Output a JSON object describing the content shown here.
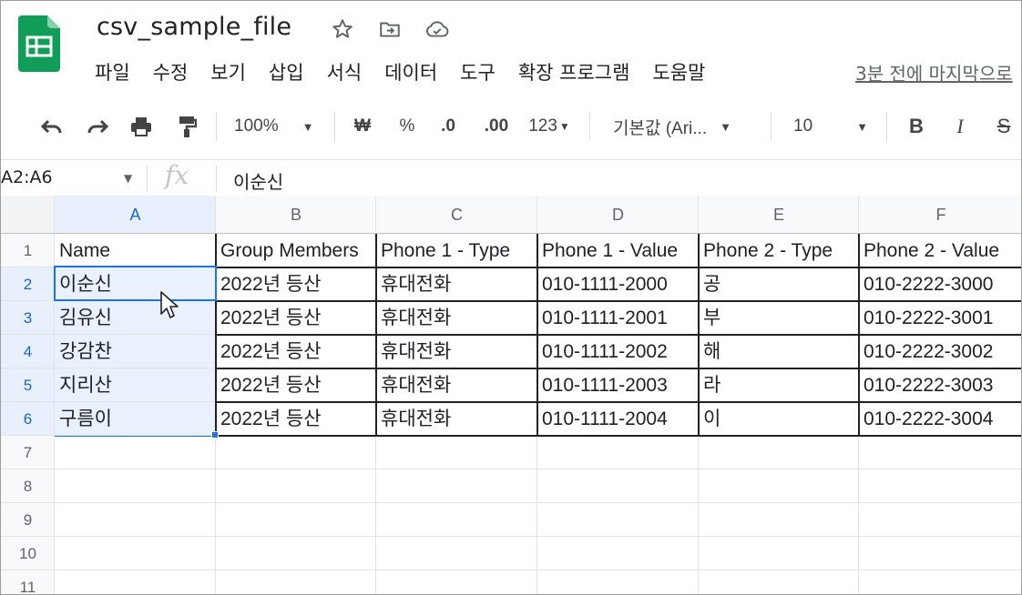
{
  "app": {
    "file_name": "csv_sample_file",
    "brand_color": "#0f9d58",
    "selection_color": "#1a73e8"
  },
  "title_icons": [
    "star-icon",
    "move-to-folder-icon",
    "cloud-saved-icon"
  ],
  "menu": {
    "items": [
      "파일",
      "수정",
      "보기",
      "삽입",
      "서식",
      "데이터",
      "도구",
      "확장 프로그램",
      "도움말"
    ],
    "last_edit": "3분 전에 마지막으로"
  },
  "toolbar": {
    "zoom": "100%",
    "currency": "₩",
    "percent": "%",
    "decimal_decrease": ".0",
    "decimal_increase": ".00",
    "format_more": "123",
    "font": "기본값 (Ari...",
    "font_size": "10",
    "bold": "B",
    "italic": "I",
    "strike": "S"
  },
  "formula_bar": {
    "name_box": "A2:A6",
    "fx": "fx",
    "value": "이순신"
  },
  "sheet": {
    "columns": [
      "A",
      "B",
      "C",
      "D",
      "E",
      "F"
    ],
    "row_numbers": [
      "1",
      "2",
      "3",
      "4",
      "5",
      "6",
      "7",
      "8",
      "9",
      "10",
      "11"
    ],
    "rows": [
      [
        "Name",
        "Group Members",
        "Phone 1 - Type",
        "Phone 1 - Value",
        "Phone 2 - Type",
        "Phone 2 - Value"
      ],
      [
        "이순신",
        "2022년 등산",
        "휴대전화",
        "010-1111-2000",
        "공",
        "010-2222-3000"
      ],
      [
        "김유신",
        "2022년 등산",
        "휴대전화",
        "010-1111-2001",
        "부",
        "010-2222-3001"
      ],
      [
        "강감찬",
        "2022년 등산",
        "휴대전화",
        "010-1111-2002",
        "해",
        "010-2222-3002"
      ],
      [
        "지리산",
        "2022년 등산",
        "휴대전화",
        "010-1111-2003",
        "라",
        "010-2222-3003"
      ],
      [
        "구름이",
        "2022년 등산",
        "휴대전화",
        "010-1111-2004",
        "이",
        "010-2222-3004"
      ]
    ]
  }
}
